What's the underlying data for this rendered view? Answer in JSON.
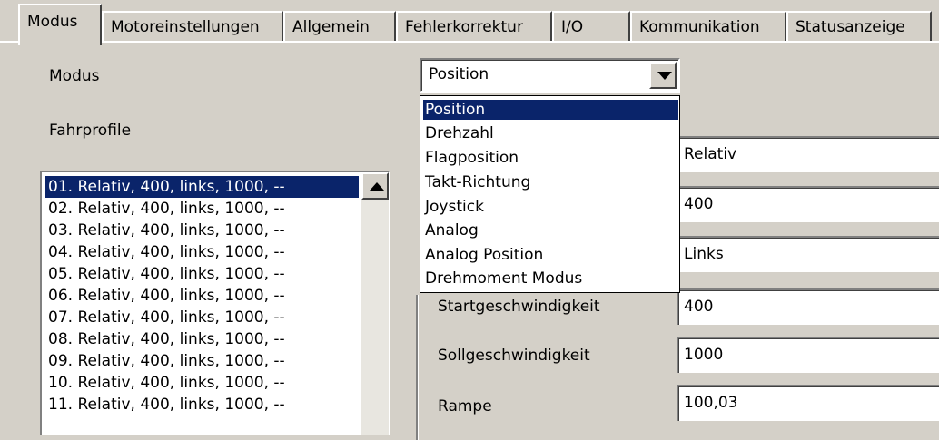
{
  "tabs": [
    "Modus",
    "Motoreinstellungen",
    "Allgemein",
    "Fehlerkorrektur",
    "I/O",
    "Kommunikation",
    "Statusanzeige"
  ],
  "labels": {
    "modus": "Modus",
    "fahrprofile": "Fahrprofile",
    "startgeschwindigkeit": "Startgeschwindigkeit",
    "sollgeschwindigkeit": "Sollgeschwindigkeit",
    "rampe": "Rampe"
  },
  "combo": {
    "value": "Position",
    "options": [
      "Position",
      "Drehzahl",
      "Flagposition",
      "Takt-Richtung",
      "Joystick",
      "Analog",
      "Analog Position",
      "Drehmoment Modus"
    ]
  },
  "profiles": [
    "01. Relativ,  400,   links,  1000, --",
    "02. Relativ,  400,   links,  1000, --",
    "03. Relativ,  400,   links,  1000, --",
    "04. Relativ,  400,   links,  1000, --",
    "05. Relativ,  400,   links,  1000, --",
    "06. Relativ,  400,   links,  1000, --",
    "07. Relativ,  400,   links,  1000, --",
    "08. Relativ,  400,   links,  1000, --",
    "09. Relativ,  400,   links,  1000, --",
    "10. Relativ,  400,   links,  1000, --",
    "11. Relativ,  400,   links,  1000, --"
  ],
  "fields": {
    "typ": "Relativ",
    "strecke": "400",
    "richtung": "Links",
    "startgeschwindigkeit": "400",
    "sollgeschwindigkeit": "1000",
    "rampe": "100,03"
  }
}
